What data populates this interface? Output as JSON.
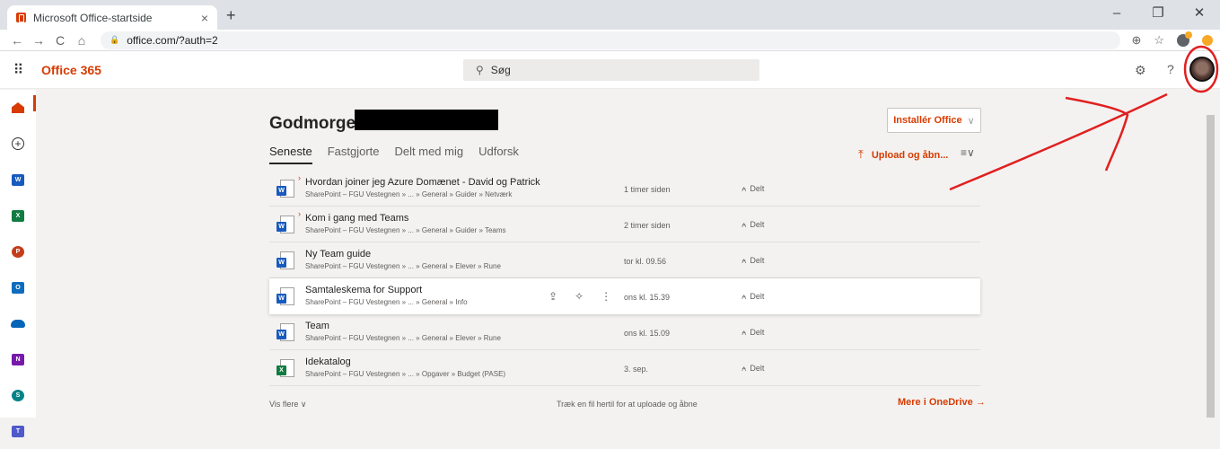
{
  "browser": {
    "tab_title": "Microsoft Office-startside",
    "tab_close": "×",
    "new_tab": "+",
    "url": "office.com/?auth=2",
    "win_min": "–",
    "win_max": "❐",
    "win_close": "✕",
    "back": "←",
    "forward": "→",
    "reload": "C",
    "home": "⌂",
    "add": "⊕",
    "star": "☆"
  },
  "header": {
    "waffle": "⠿",
    "brand": "Office 365",
    "search_placeholder": "Søg",
    "search_icon": "⚲",
    "settings_icon": "⚙",
    "help_icon": "?"
  },
  "rail": {
    "items": [
      {
        "name": "home",
        "label": ""
      },
      {
        "name": "create",
        "label": "+"
      },
      {
        "name": "word",
        "label": "W",
        "color": "#185abd"
      },
      {
        "name": "excel",
        "label": "X",
        "color": "#107c41"
      },
      {
        "name": "powerpoint",
        "label": "P",
        "color": "#c43e1c"
      },
      {
        "name": "outlook",
        "label": "O",
        "color": "#0f6cbd"
      },
      {
        "name": "onedrive",
        "label": "",
        "color": "#0364b8"
      },
      {
        "name": "onenote",
        "label": "N",
        "color": "#7719aa"
      },
      {
        "name": "sharepoint",
        "label": "S",
        "color": "#038387"
      },
      {
        "name": "teams",
        "label": "T",
        "color": "#5059c9"
      }
    ]
  },
  "main": {
    "greeting": "Godmorgen",
    "install_label": "Installér Office",
    "install_chev": "∨",
    "tabs": [
      {
        "label": "Seneste"
      },
      {
        "label": "Fastgjorte"
      },
      {
        "label": "Delt med mig"
      },
      {
        "label": "Udforsk"
      }
    ],
    "upload_arrow": "⤒",
    "upload_label": "Upload og åbn...",
    "sort_icon": "≡∨",
    "files": [
      {
        "name": "Hvordan joiner jeg Azure Domænet - David og Patrick",
        "path": "SharePoint – FGU Vestegnen » ... » General » Guider » Netværk",
        "time": "1 timer siden",
        "share": "Delt",
        "type": "word",
        "badge": "W",
        "new": "›"
      },
      {
        "name": "Kom i gang med Teams",
        "path": "SharePoint – FGU Vestegnen » ... » General » Guider » Teams",
        "time": "2 timer siden",
        "share": "Delt",
        "type": "word",
        "badge": "W",
        "new": "›"
      },
      {
        "name": "Ny Team guide",
        "path": "SharePoint – FGU Vestegnen » ... » General » Elever » Rune",
        "time": "tor kl. 09.56",
        "share": "Delt",
        "type": "word",
        "badge": "W",
        "new": ""
      },
      {
        "name": "Samtaleskema for Support",
        "path": "SharePoint – FGU Vestegnen » ... » General » Info",
        "time": "ons kl. 15.39",
        "share": "Delt",
        "type": "word",
        "badge": "W",
        "new": ""
      },
      {
        "name": "Team",
        "path": "SharePoint – FGU Vestegnen » ... » General » Elever » Rune",
        "time": "ons kl. 15.09",
        "share": "Delt",
        "type": "word",
        "badge": "W",
        "new": ""
      },
      {
        "name": "Idekatalog",
        "path": "SharePoint – FGU Vestegnen » ... » Opgaver » Budget (PASE)",
        "time": "3. sep.",
        "share": "Delt",
        "type": "excel",
        "badge": "X",
        "new": ""
      }
    ],
    "share_icon": "⍲",
    "row_action_share": "⇪",
    "row_action_pin": "✧",
    "row_action_more": "⋮",
    "more_label": "Vis flere ∨",
    "drag_text": "Træk en fil hertil for at uploade og åbne",
    "onedrive_label": "Mere i OneDrive →"
  },
  "colors": {
    "accent": "#d83b01",
    "annotation": "#e02020"
  }
}
